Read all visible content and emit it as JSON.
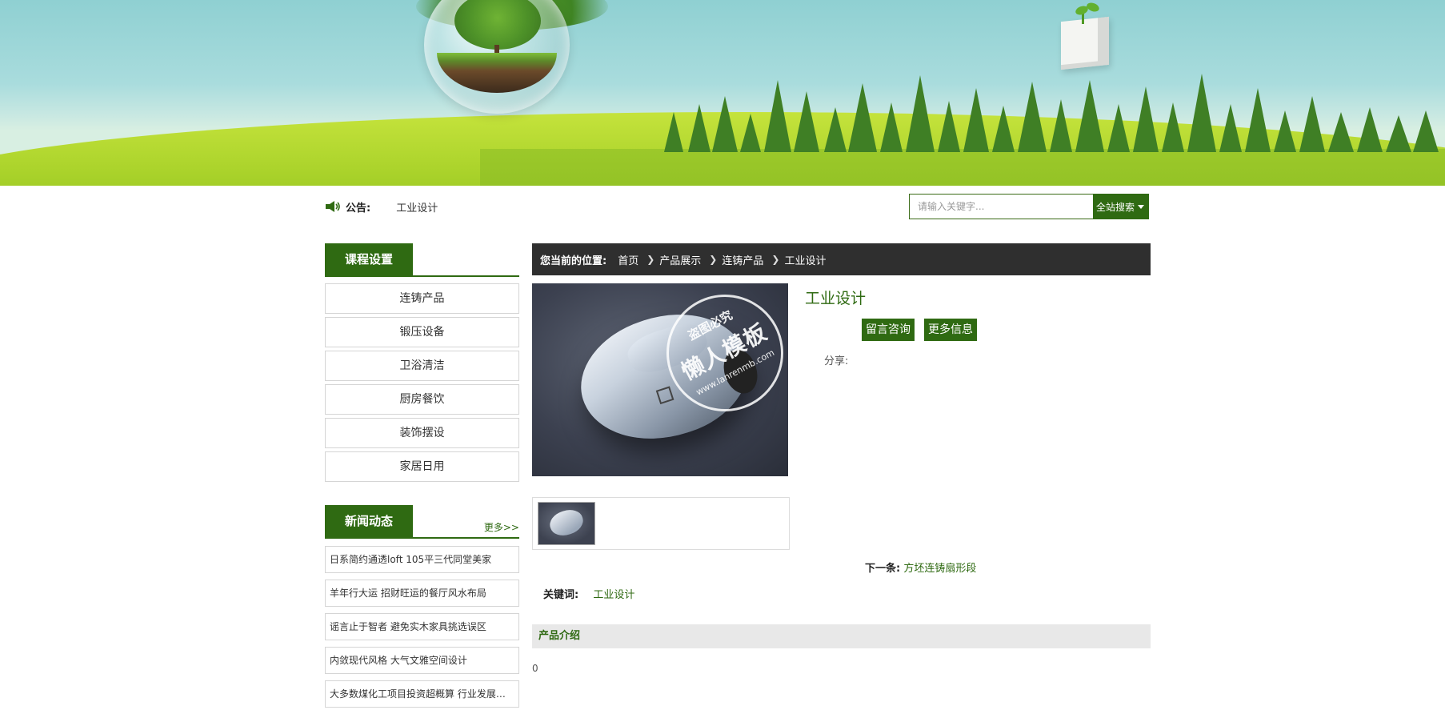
{
  "notice": {
    "label": "公告:",
    "text": "工业设计"
  },
  "search": {
    "placeholder": "请输入关键字...",
    "button_label": "全站搜索"
  },
  "sidebar": {
    "categories_title": "课程设置",
    "categories": [
      "连铸产品",
      "锻压设备",
      "卫浴清洁",
      "厨房餐饮",
      "装饰摆设",
      "家居日用"
    ],
    "news_title": "新闻动态",
    "news_more": "更多>>",
    "news": [
      "日系简约通透loft 105平三代同堂美家",
      "羊年行大运 招财旺运的餐厅风水布局",
      "谣言止于智者 避免实木家具挑选误区",
      "内敛现代风格 大气文雅空间设计",
      "大多数煤化工项目投资超概算 行业发展遭遇瓶颈"
    ]
  },
  "breadcrumb": {
    "lead": "您当前的位置:",
    "items": [
      "首页",
      "产品展示",
      "连铸产品",
      "工业设计"
    ]
  },
  "product": {
    "title": "工业设计",
    "watermark": {
      "line1": "盗图必究",
      "line2": "懒人模板",
      "line3": "www.lanrenmb.com"
    },
    "buttons": {
      "consult": "留言咨询",
      "more_info": "更多信息"
    },
    "share_label": "分享:",
    "next_label": "下一条:",
    "next_link": "方坯连铸扇形段",
    "keywords_label": "关键词:",
    "keywords_value": "工业设计",
    "intro_title": "产品介绍",
    "intro_body": "0"
  },
  "colors": {
    "accent": "#2f6a12",
    "crumb_bg": "#2f2f2f",
    "intro_bg": "#e8e8e8"
  }
}
